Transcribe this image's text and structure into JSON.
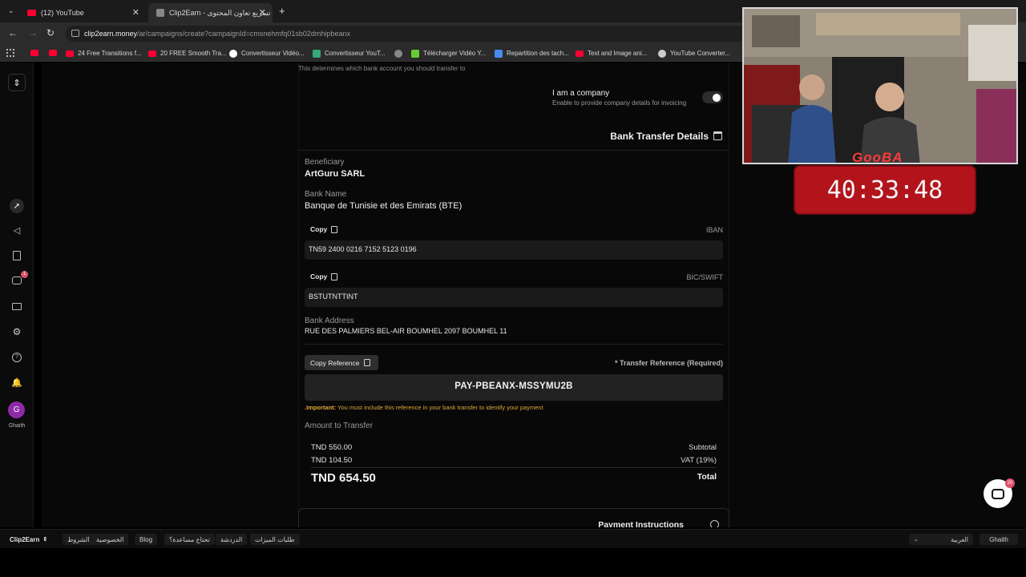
{
  "browser": {
    "tabs": [
      {
        "title": "(12) YouTube"
      },
      {
        "title": "Clip2Earn - تسريع تعاون المحتوى"
      }
    ],
    "url_host": "clip2earn.money",
    "url_path": "/ar/campaigns/create?campaignId=cmsnehmfq01sb02dmhipbeanx",
    "bookmarks": [
      {
        "label": "24 Free Transitions f...",
        "icon": "youtube-icon"
      },
      {
        "label": "20 FREE Smooth Tra...",
        "icon": "youtube-icon"
      },
      {
        "label": "Convertisseur Vidéo...",
        "icon": "google-icon"
      },
      {
        "label": "Convertisseur YouT...",
        "icon": "converter-icon"
      },
      {
        "label": "Télécharger Vidéo Y...",
        "icon": "download-icon"
      },
      {
        "label": "Repartition des tach...",
        "icon": "docs-icon"
      },
      {
        "label": "Text and Image ani...",
        "icon": "youtube-icon"
      },
      {
        "label": "YouTube Converter...",
        "icon": "globe-icon"
      }
    ]
  },
  "page": {
    "top_hint": "This determines which bank account you should transfer to",
    "company_toggle": {
      "title": "I am a company",
      "subtitle": "Enable to provide company details for invoicing",
      "on": true
    },
    "section_title": "Bank Transfer Details",
    "beneficiary": {
      "label": "Beneficiary",
      "value": "ArtGuru SARL"
    },
    "bank_name": {
      "label": "Bank Name",
      "value": "Banque de Tunisie et des Emirats (BTE)"
    },
    "iban": {
      "copy": "Copy",
      "label": "IBAN",
      "value": "TN59 2400 0216 7152 5123 0196"
    },
    "bic": {
      "copy": "Copy",
      "label": "BIC/SWIFT",
      "value": "BSTUTNTTINT"
    },
    "bank_address": {
      "label": "Bank Address",
      "value": "RUE DES PALMIERS BEL-AIR BOUMHEL 2097 BOUMHEL 11"
    },
    "reference": {
      "copy": "Copy Reference",
      "label": "* Transfer Reference (Required)",
      "value": "PAY-PBEANX-MSSYMU2B",
      "note_bold": ".Important:",
      "note": "You must include this reference in your bank transfer to identify your payment"
    },
    "amount": {
      "label": "Amount to Transfer",
      "subtotal_value": "TND 550.00",
      "subtotal_label": "Subtotal",
      "vat_value": "TND 104.50",
      "vat_label": "VAT (19%)",
      "total_value": "TND 654.50",
      "total_label": "Total"
    },
    "instructions_title": "Payment Instructions"
  },
  "sidebar": {
    "user_initial": "G",
    "user_name": "Ghaith",
    "notification_badge": "1"
  },
  "overlay": {
    "timer": "40:33:48",
    "logo_text": "GooBA"
  },
  "chat_badge": "20",
  "bottom_bar": {
    "brand": "Clip2Earn",
    "items": [
      "الشروط",
      "الخصوصية",
      "Blog",
      "تحتاج مساعدة؟",
      "الدردشة",
      "طلبات الميزات"
    ],
    "language": "العربية",
    "user": "Ghaith"
  },
  "colors": {
    "note_accent": "#e0a63a",
    "timer_bg": "#b3141c",
    "youtube_red": "#ff0033",
    "page_bg": "#080808"
  }
}
